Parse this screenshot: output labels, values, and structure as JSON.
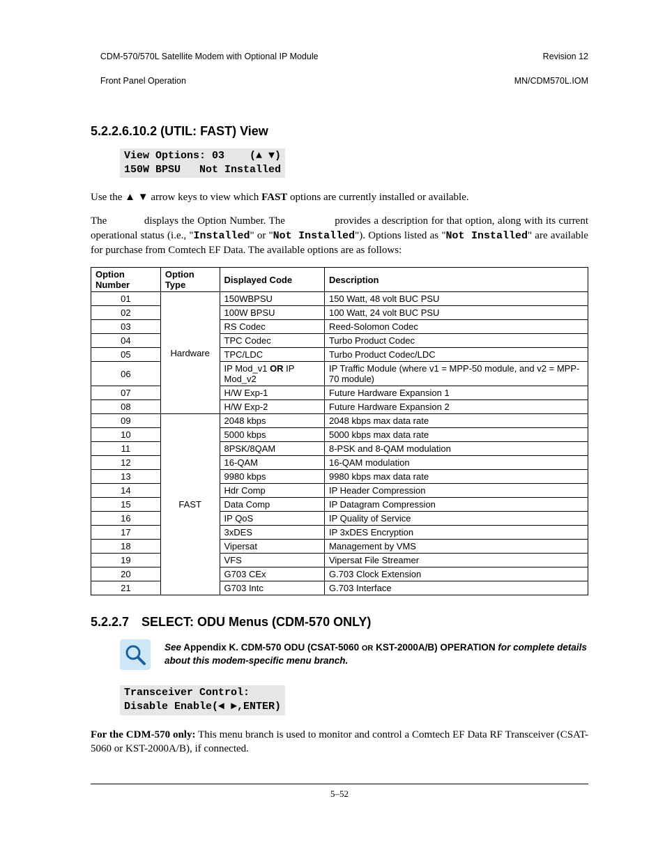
{
  "header": {
    "left_line1": "CDM-570/570L Satellite Modem with Optional IP Module",
    "left_line2": "Front Panel Operation",
    "right_line1": "Revision 12",
    "right_line2": "MN/CDM570L.IOM"
  },
  "section1": {
    "number": "5.2.2.6.10.2",
    "title": "(UTIL: FAST) View",
    "terminal": "View Options: 03    (▲ ▼)\n150W BPSU   Not Installed",
    "para1_a": "Use the ▲ ▼ arrow keys to view which ",
    "para1_fast": "FAST",
    "para1_b": " options are currently installed or available.",
    "para2_a": "The ",
    "para2_gap1": "           ",
    "para2_b": "displays the Option Number. The ",
    "para2_gap2": "               ",
    "para2_c": "provides a description for that option, along with its current operational status (i.e., \"",
    "para2_installed": "Installed",
    "para2_d": "\" or \"",
    "para2_notinst": "Not Installed",
    "para2_e": "\").  Options listed as \"",
    "para2_notinst2": "Not Installed",
    "para2_f": "\" are available for purchase from Comtech EF Data. The available options are as follows:"
  },
  "table": {
    "headers": [
      "Option Number",
      "Option Type",
      "Displayed Code",
      "Description"
    ],
    "groups": [
      {
        "type": "Hardware",
        "rows": [
          {
            "num": "01",
            "code": "150WBPSU",
            "desc": "150 Watt, 48 volt BUC PSU"
          },
          {
            "num": "02",
            "code": "100W BPSU",
            "desc": "100 Watt, 24 volt BUC PSU"
          },
          {
            "num": "03",
            "code": "RS Codec",
            "desc": "Reed-Solomon Codec"
          },
          {
            "num": "04",
            "code": "TPC Codec",
            "desc": "Turbo Product Codec"
          },
          {
            "num": "05",
            "code": "TPC/LDC",
            "desc": "Turbo Product Codec/LDC"
          },
          {
            "num": "06",
            "code_parts": [
              "IP Mod_v1 ",
              "OR",
              " IP Mod_v2"
            ],
            "desc": "IP Traffic Module (where v1 = MPP-50 module, and v2 = MPP-70 module)"
          },
          {
            "num": "07",
            "code": "H/W Exp-1",
            "desc": "Future Hardware Expansion 1"
          },
          {
            "num": "08",
            "code": "H/W Exp-2",
            "desc": "Future Hardware Expansion 2"
          }
        ]
      },
      {
        "type": "FAST",
        "rows": [
          {
            "num": "09",
            "code": "2048 kbps",
            "desc": "2048 kbps max data rate"
          },
          {
            "num": "10",
            "code": "5000 kbps",
            "desc": "5000 kbps max data rate"
          },
          {
            "num": "11",
            "code": "8PSK/8QAM",
            "desc": "8-PSK and 8-QAM modulation"
          },
          {
            "num": "12",
            "code": "16-QAM",
            "desc": "16-QAM modulation"
          },
          {
            "num": "13",
            "code": "9980 kbps",
            "desc": "9980 kbps max data rate"
          },
          {
            "num": "14",
            "code": "Hdr Comp",
            "desc": "IP Header Compression"
          },
          {
            "num": "15",
            "code": "Data Comp",
            "desc": "IP Datagram Compression"
          },
          {
            "num": "16",
            "code": "IP QoS",
            "desc": "IP Quality of Service"
          },
          {
            "num": "17",
            "code": "3xDES",
            "desc": "IP 3xDES Encryption"
          },
          {
            "num": "18",
            "code": "Vipersat",
            "desc": "Management by VMS"
          },
          {
            "num": "19",
            "code": "VFS",
            "desc": "Vipersat File Streamer"
          },
          {
            "num": "20",
            "code": "G703 CEx",
            "desc": "G.703 Clock Extension"
          },
          {
            "num": "21",
            "code": "G703 Intc",
            "desc": "G.703 Interface"
          }
        ]
      }
    ]
  },
  "section2": {
    "number": "5.2.2.7",
    "title": "SELECT: ODU Menus (CDM-570 ONLY)",
    "callout_a": "See",
    "callout_b": " Appendix K. CDM-570 ODU (CSAT-5060 ",
    "callout_or": "OR",
    "callout_c": " KST-2000A/B) OPERATION ",
    "callout_d": "for complete details about this modem-specific menu branch.",
    "terminal": "Transceiver Control:\nDisable Enable(◄ ►,ENTER)",
    "para_a": "For the CDM-570 only:",
    "para_b": " This menu branch is used to monitor and control a Comtech EF Data RF Transceiver (CSAT-5060 or KST-2000A/B), if connected."
  },
  "footer": "5–52"
}
